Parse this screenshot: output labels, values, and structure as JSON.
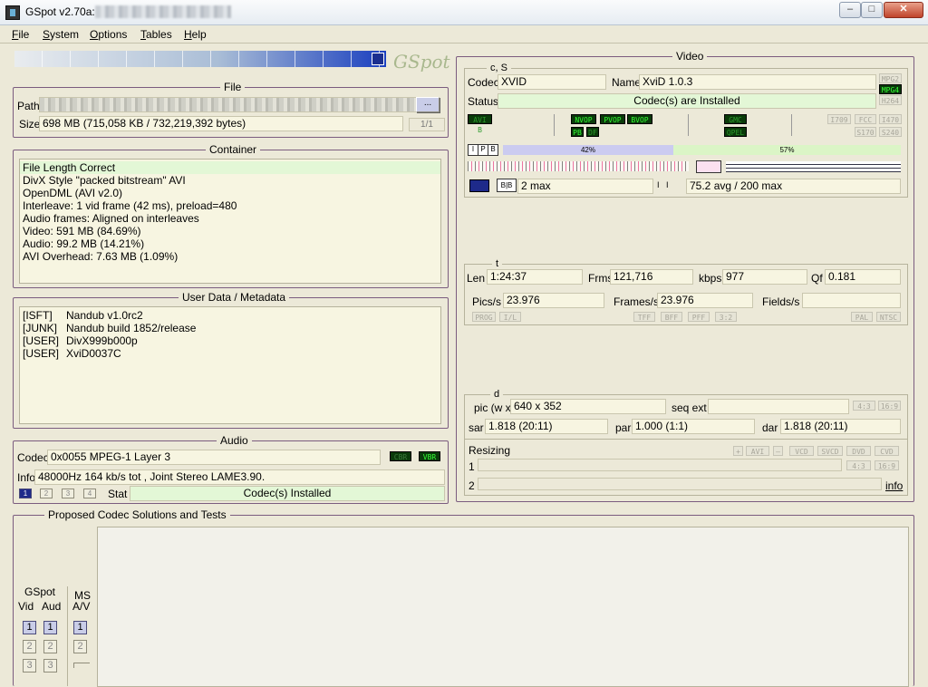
{
  "window": {
    "title": "GSpot v2.70a:",
    "minimize": "–",
    "maximize": "□",
    "close": "✕"
  },
  "menu": [
    {
      "first": "F",
      "rest": "ile"
    },
    {
      "first": "S",
      "rest": "ystem"
    },
    {
      "first": "O",
      "rest": "ptions"
    },
    {
      "first": "T",
      "rest": "ables"
    },
    {
      "first": "H",
      "rest": "elp"
    }
  ],
  "logo": "GSpot",
  "file": {
    "title": "File",
    "path_label": "Path",
    "browse": "...",
    "size_label": "Size",
    "size_value": "698 MB (715,058 KB / 732,219,392 bytes)",
    "counter": "1/1"
  },
  "container": {
    "title": "Container",
    "lines": [
      "File Length Correct",
      "DivX Style \"packed bitstream\" AVI",
      "OpenDML (AVI v2.0)",
      "Interleave: 1 vid frame (42 ms), preload=480",
      "Audio frames: Aligned on interleaves",
      "Video: 591 MB (84.69%)",
      "Audio: 99.2 MB (14.21%)",
      "AVI Overhead: 7.63 MB (1.09%)"
    ]
  },
  "metadata": {
    "title": "User Data / Metadata",
    "rows": [
      {
        "tag": "[ISFT]",
        "value": "Nandub v1.0rc2"
      },
      {
        "tag": "[JUNK]",
        "value": "Nandub build 1852/release"
      },
      {
        "tag": "[USER]",
        "value": "DivX999b000p"
      },
      {
        "tag": "[USER]",
        "value": "XviD0037C"
      }
    ]
  },
  "audio": {
    "title": "Audio",
    "codec_label": "Codec",
    "codec_value": "0x0055 MPEG-1 Layer 3",
    "cbr": "CBR",
    "vbr": "VBR",
    "info_label": "Info",
    "info_value": "48000Hz  164 kb/s tot , Joint Stereo LAME3.90.",
    "streams": [
      "1",
      "2",
      "3",
      "4"
    ],
    "stat_label": "Stat",
    "stat_value": "Codec(s) Installed"
  },
  "video": {
    "title": "Video",
    "cs_title": "c, S",
    "codec_label": "Codec",
    "codec_value": "XVID",
    "name_label": "Name",
    "name_value": "XviD 1.0.3",
    "status_label": "Status",
    "status_value": "Codec(s) are Installed",
    "fmt_badges": [
      "MPG2",
      "MPG4",
      "H264"
    ],
    "flags_row1": [
      "AVI B",
      "NVOP",
      "PVOP",
      "BVOP",
      "GMC",
      "I709",
      "FCC",
      "I470"
    ],
    "flags_row2": [
      "PB",
      "DF",
      "QPEL",
      "S170",
      "S240"
    ],
    "ipb_letters": [
      "I",
      "P",
      "B"
    ],
    "pct_left": "42%",
    "pct_right": "57%",
    "b_label": "B",
    "b_max": "2 max",
    "i_label": "I",
    "i_value": "75.2 avg / 200 max",
    "t_title": "t",
    "len_label": "Len",
    "len_value": "1:24:37",
    "frms_label": "Frms",
    "frms_value": "121,716",
    "kbps_label": "kbps",
    "kbps_value": "977",
    "qf_label": "Qf",
    "qf_value": "0.181",
    "pics_label": "Pics/s",
    "pics_value": "23.976",
    "frames_label": "Frames/s",
    "frames_value": "23.976",
    "fields_label": "Fields/s",
    "fields_value": "",
    "mode_badges_left": [
      "PROG",
      "I/L"
    ],
    "mode_badges_mid": [
      "TFF",
      "BFF",
      "PFF",
      "3:2"
    ],
    "mode_badges_right": [
      "PAL",
      "NTSC"
    ],
    "d_title": "d",
    "pic_label": "pic (w x",
    "pic_value": "640 x 352",
    "seqext_label": "seq ext",
    "seqext_value": "",
    "aspect_badges": [
      "4:3",
      "16:9"
    ],
    "sar_label": "sar",
    "sar_value": "1.818 (20:11)",
    "par_label": "par",
    "par_value": "1.000 (1:1)",
    "dar_label": "dar",
    "dar_value": "1.818 (20:11)",
    "resizing_label": "Resizing",
    "resize_buttons": [
      "+",
      "AVI",
      "–",
      "VCD",
      "SVCD",
      "DVD",
      "CVD"
    ],
    "r1_label": "1",
    "r2_label": "2",
    "info_link": "info"
  },
  "codec_tests": {
    "title": "Proposed Codec Solutions and Tests",
    "gspot_label": "GSpot",
    "vid_label": "Vid",
    "aud_label": "Aud",
    "ms_label": "MS",
    "av_label": "A/V",
    "nums": [
      "1",
      "2",
      "3"
    ]
  }
}
